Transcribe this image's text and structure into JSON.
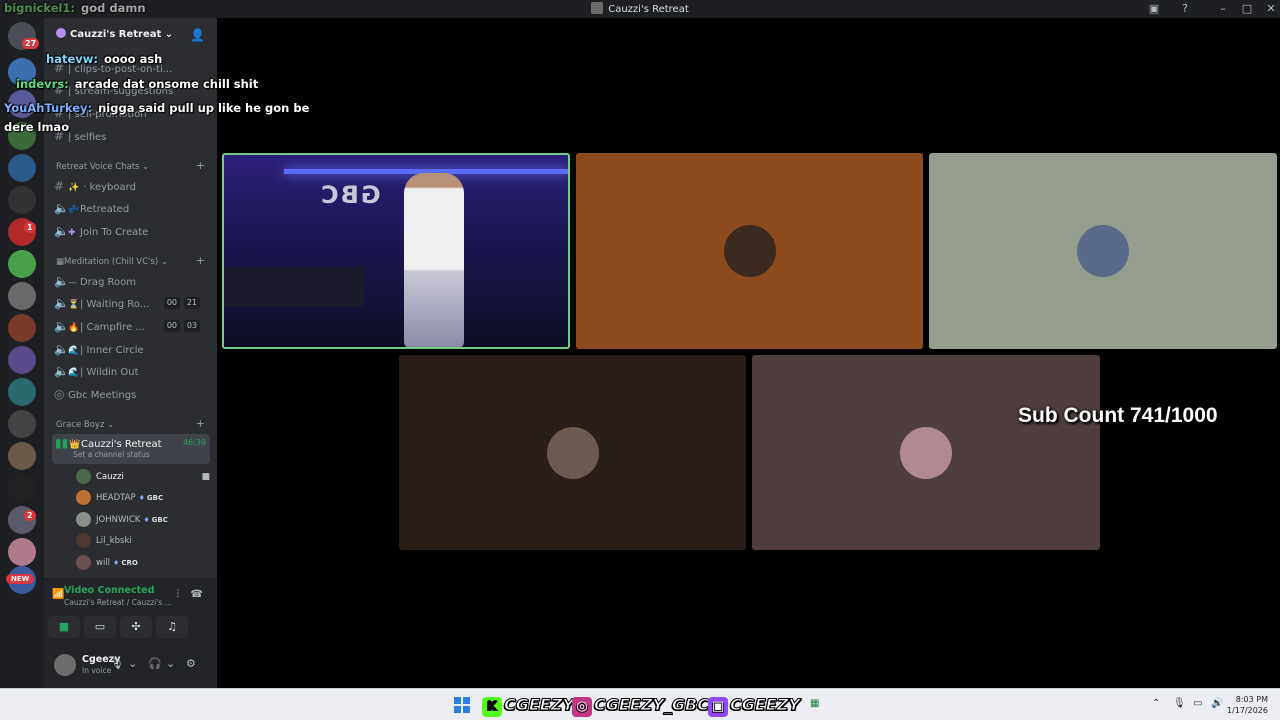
{
  "window": {
    "title": "Cauzzi's Retreat"
  },
  "server": {
    "name": "Cauzzi's Retreat"
  },
  "rail": {
    "badges": {
      "top": "27",
      "red1": "1",
      "red2": "2"
    },
    "new_label": "NEW"
  },
  "channels": {
    "text": [
      {
        "name": "| clips-to-post-on-ti..."
      },
      {
        "name": "| stream-suggestions"
      },
      {
        "name": "| self-promotion"
      },
      {
        "name": "| selfies"
      }
    ],
    "cat_retreat": "Retreat Voice Chats",
    "keyboard": "keyboard",
    "retreated": "Retreated",
    "join_to_create": "Join To Create",
    "cat_meditation": "Meditation (Chill VC's)",
    "drag_room": "Drag Room",
    "waiting_room": "| Waiting Ro...",
    "waiting_counts": [
      "00",
      "21"
    ],
    "campfire": "| Campfire ...",
    "campfire_counts": [
      "00",
      "03"
    ],
    "inner_circle": "| Inner Circle",
    "wildin_out": "| Wildin Out",
    "gbc_meetings": "Gbc Meetings",
    "cat_grace": "Grace Boyz",
    "active": {
      "name": "Cauzzi's Retreat",
      "timer": "46:39",
      "status": "Set a channel status"
    }
  },
  "voice_users": [
    {
      "name": "Cauzzi",
      "tag": ""
    },
    {
      "name": "HEADTAP",
      "tag": "GBC"
    },
    {
      "name": "JOHNWICK",
      "tag": "GBC"
    },
    {
      "name": "Lil_kbski",
      "tag": ""
    },
    {
      "name": "will",
      "tag": "CRO"
    }
  ],
  "voice_panel": {
    "status": "Video Connected",
    "location": "Cauzzi's Retreat / Cauzzi's ..."
  },
  "user": {
    "name": "Cgeezy",
    "status": "In voice"
  },
  "chat": [
    {
      "user": "bignickel1:",
      "msg": "god damn",
      "color": "#6fd36f"
    },
    {
      "user": "hatevw:",
      "msg": "oooo ash",
      "color": "#7dd7ff"
    },
    {
      "user": "indevrs:",
      "msg": "arcade dat onsome chill shit",
      "color": "#5bdc82"
    },
    {
      "user": "YouAhTurkey:",
      "msg": "nigga said pull up like he gon be",
      "color": "#7fb0ff"
    },
    {
      "user": "",
      "msg": "dere lmao",
      "color": "#ffffff"
    }
  ],
  "tiles": {
    "colors": {
      "t2": "#8d4a1d",
      "t3": "#959d8f",
      "t4": "#2a1e19",
      "t5": "#4e3e3e"
    },
    "cam_wall_text": "GBC"
  },
  "sub_count": "Sub Count 741/1000",
  "taskbar": {
    "kick": "CGEEZY",
    "instagram": "CGEEZY_GBC",
    "twitch": "CGEEZY",
    "time": "8:03 PM",
    "date": "1/17/2026"
  }
}
